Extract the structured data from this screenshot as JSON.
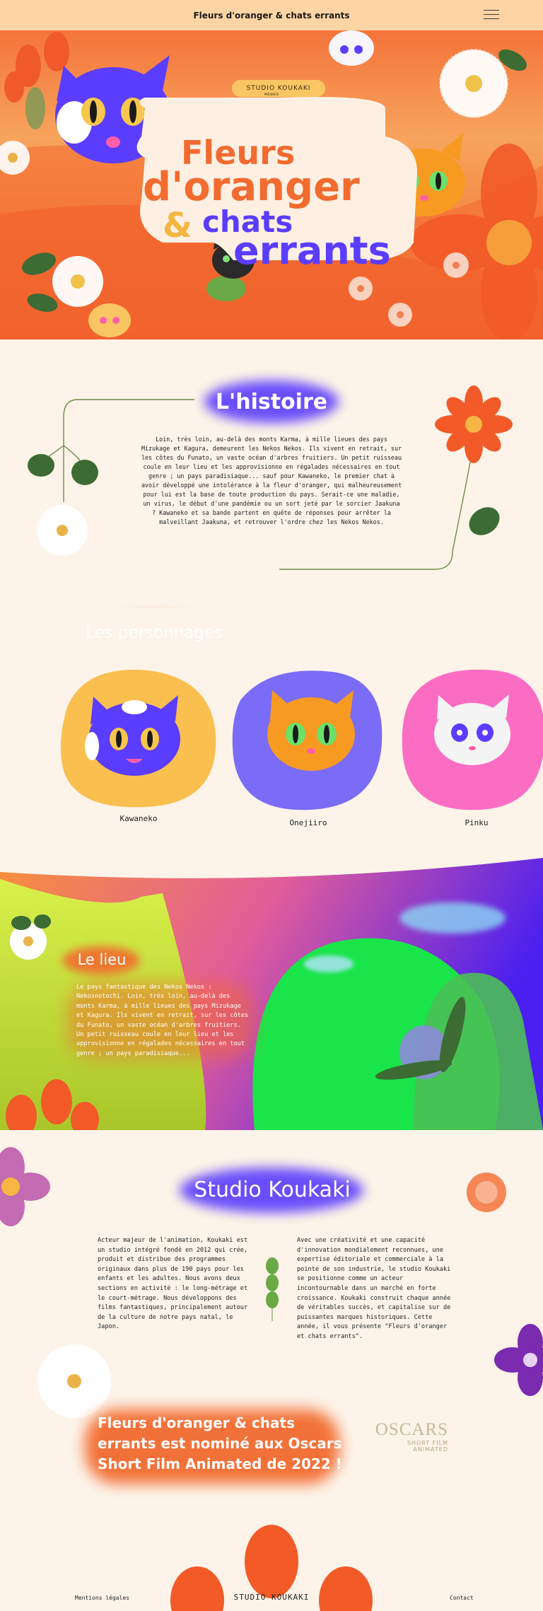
{
  "header": {
    "title": "Fleurs d'oranger & chats errants",
    "menu_icon": "hamburger-icon"
  },
  "hero": {
    "studio_label": "STUDIO KOUKAKI",
    "presente": "PRÉSENTE",
    "title_line1": "Fleurs",
    "title_line2": "d'oranger",
    "title_amp": "&",
    "title_line3": "chats",
    "title_line4": "errants"
  },
  "story": {
    "heading": "L'histoire",
    "text": "Loin, très loin, au-delà des monts Karma, à mille lieues des pays Mizukage et Kagura, demeurent les Nekos Nekos. Ils vivent en retrait, sur les côtes du Funato, un vaste océan d'arbres fruitiers. Un petit ruisseau coule en leur lieu et les approvisionne en régalades nécessaires en tout genre ; un pays paradisiaque... sauf pour Kawaneko, le premier chat à avoir développé une intolérance à la fleur d'oranger, qui malheureusement pour lui est la base de toute production du pays. Serait-ce une maladie, un virus, le début d'une pandémie ou un sort jeté par le sorcier Jaakuna ? Kawaneko et sa bande partent en quête de réponses pour arrêter la malveillant Jaakuna, et retrouver l'ordre chez les Nekos Nekos."
  },
  "characters": {
    "heading": "Les personnages",
    "items": [
      {
        "name": "Kawaneko",
        "blob_color": "#f9bf4f",
        "cat_color": "#5b3dff"
      },
      {
        "name": "Onejiiro",
        "blob_color": "#7a6cf6",
        "cat_color": "#f79a22"
      },
      {
        "name": "Pinku",
        "blob_color": "#fb6dc3",
        "cat_color": "#f4f4f4"
      }
    ]
  },
  "place": {
    "heading": "Le lieu",
    "text": "Le pays fantastique des Nekos Nekos : Nekosnotochi. Loin, très loin, au-delà des monts Karma, à mille lieues des pays Mizukage et Kagura. Ils vivent en retrait, sur les côtes du Funato, un vaste océan d'arbres fruitiers. Un petit ruisseau coule en leur lieu et les approvisionne en régalades nécessaires en tout genre ; un pays paradisiaque..."
  },
  "studio": {
    "heading": "Studio Koukaki",
    "col1": "Acteur majeur de l'animation, Koukaki est un studio intégré fondé en 2012 qui crée, produit et distribue des programmes originaux dans plus de 190 pays pour les enfants et les adultes. Nous avons deux sections en activité : le long-métrage et le court-métrage. Nous développons des films fantastiques, principalement autour de la culture de notre pays natal, le Japon.",
    "col2": "Avec une créativité et une capacité d'innovation mondialement reconnues, une expertise éditoriale et commerciale à la pointe de son industrie, le studio Koukaki se positionne comme un acteur incontournable dans un marché en forte croissance. Koukaki construit chaque année de véritables succès, et capitalise sur de puissantes marques historiques. Cette année, il vous présente \"Fleurs d'oranger et chats errants\".",
    "nomination": "Fleurs d'oranger & chats errants est nominé aux Oscars Short Film Animated de 2022 !",
    "oscars_main": "OSCARS",
    "oscars_sub1": "SHORT FILM",
    "oscars_sub2": "ANIMATED"
  },
  "footer": {
    "left": "Mentions légales",
    "center": "STUDIO KOUKAKI",
    "right": "Contact"
  },
  "colors": {
    "orange": "#f26b2f",
    "purple": "#5b3dff",
    "yellow": "#f9c663",
    "cream": "#fdf3e8"
  }
}
